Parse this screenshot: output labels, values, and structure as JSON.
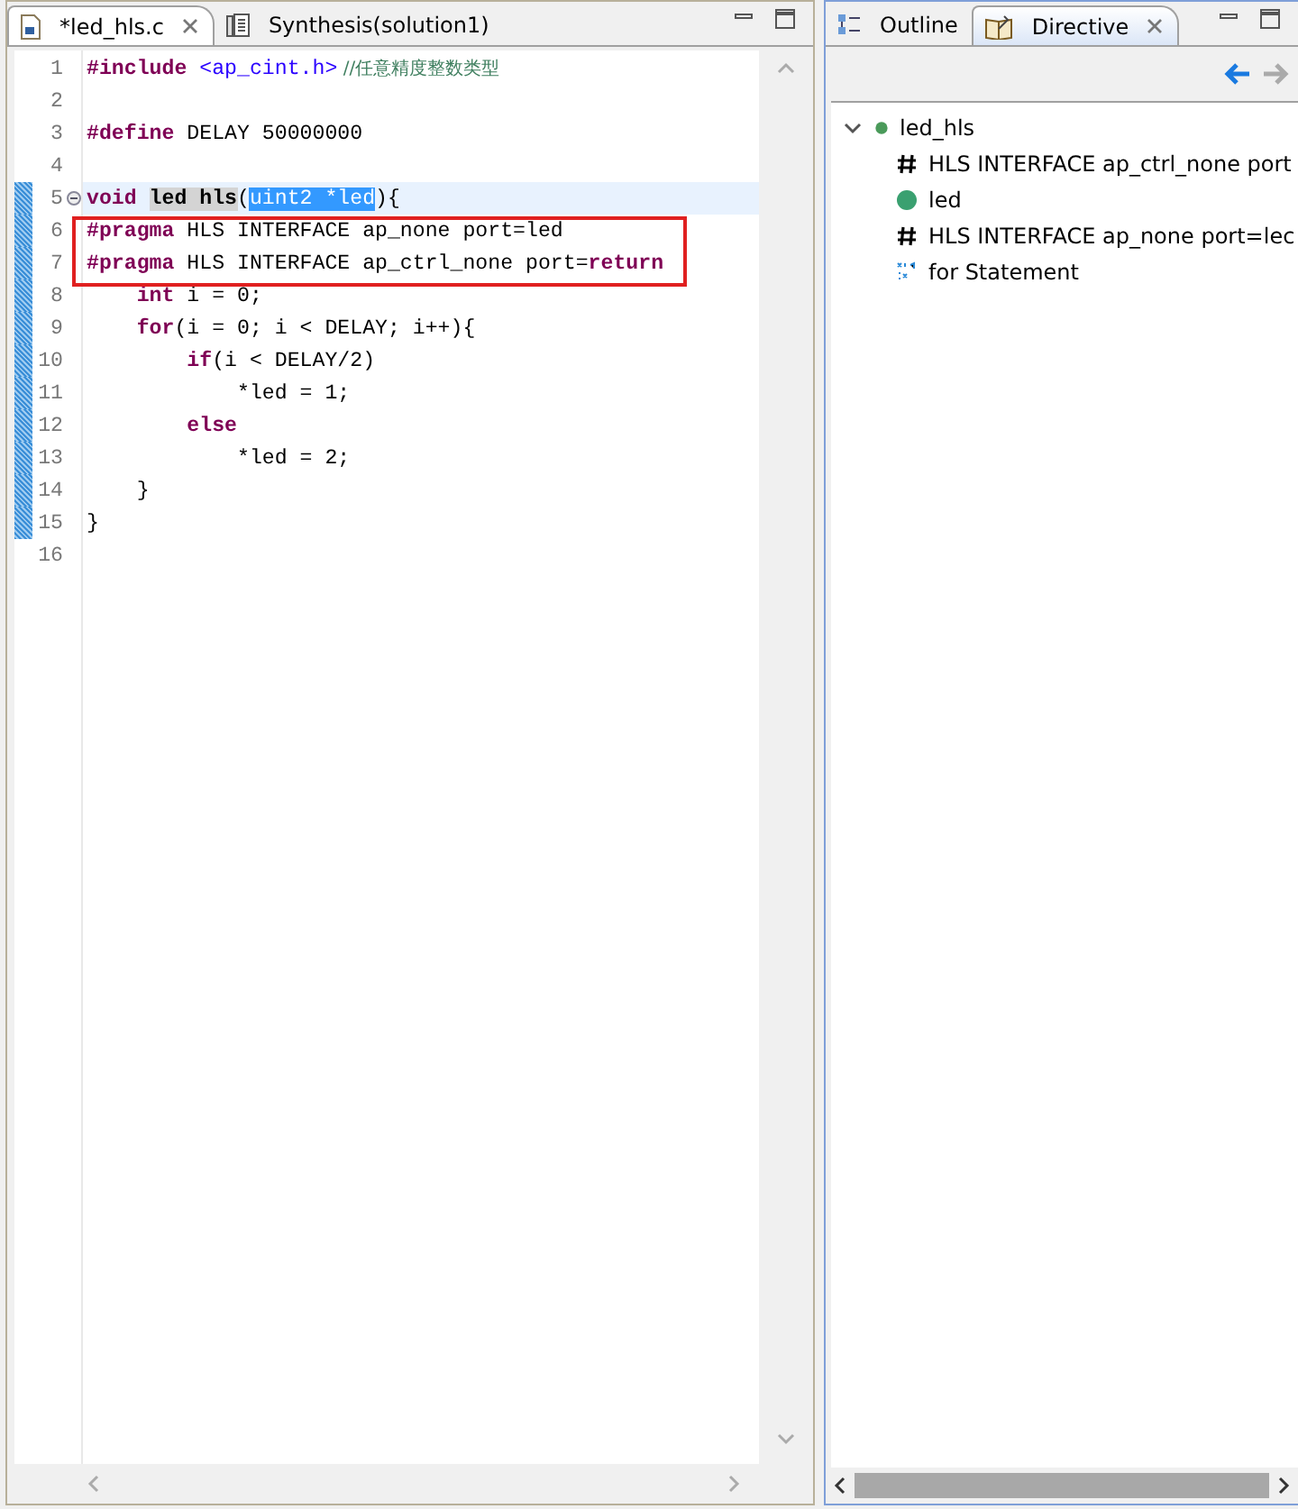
{
  "editor": {
    "tabs": [
      {
        "label": "*led_hls.c",
        "kind": "source",
        "selected": true,
        "closable": true
      },
      {
        "label": "Synthesis(solution1)",
        "kind": "report",
        "selected": false,
        "closable": false
      }
    ],
    "lines": [
      {
        "number": "1",
        "changed": false,
        "current": false,
        "tokens": [
          {
            "kind": "keyword",
            "text": "#include"
          },
          {
            "kind": "header",
            "text": " <ap_cint.h>"
          },
          {
            "kind": "comment",
            "text": " //任意精度整数类型"
          }
        ]
      },
      {
        "number": "2",
        "changed": false,
        "current": false
      },
      {
        "number": "3",
        "changed": false,
        "current": false,
        "tokens": [
          {
            "kind": "keyword",
            "text": "#define"
          },
          {
            "kind": "plain",
            "text": " DELAY 50000000"
          }
        ]
      },
      {
        "number": "4",
        "changed": false,
        "current": false
      },
      {
        "number": "5",
        "changed": true,
        "current": true,
        "fold": true,
        "tokens": [
          {
            "kind": "keyword",
            "text": "void "
          },
          {
            "kind": "occurrence",
            "text": "led hls"
          },
          {
            "kind": "plain",
            "text": "("
          },
          {
            "kind": "selection",
            "text": "uint2 *led"
          },
          {
            "kind": "plain",
            "text": "){"
          }
        ]
      },
      {
        "number": "6",
        "changed": true,
        "current": false,
        "tokens": [
          {
            "kind": "keyword",
            "text": "#pragma"
          },
          {
            "kind": "plain",
            "text": " HLS INTERFACE ap_none port=led"
          }
        ]
      },
      {
        "number": "7",
        "changed": true,
        "current": false,
        "tokens": [
          {
            "kind": "keyword",
            "text": "#pragma"
          },
          {
            "kind": "plain",
            "text": " HLS INTERFACE ap_ctrl_none port="
          },
          {
            "kind": "keyword",
            "text": "return"
          }
        ]
      },
      {
        "number": "8",
        "changed": true,
        "current": false,
        "tokens": [
          {
            "kind": "keyword",
            "text": "    int"
          },
          {
            "kind": "plain",
            "text": " i = 0;"
          }
        ]
      },
      {
        "number": "9",
        "changed": true,
        "current": false,
        "tokens": [
          {
            "kind": "keyword",
            "text": "    for"
          },
          {
            "kind": "plain",
            "text": "(i = 0; i < DELAY; i++){"
          }
        ]
      },
      {
        "number": "10",
        "changed": true,
        "current": false,
        "tokens": [
          {
            "kind": "keyword",
            "text": "        if"
          },
          {
            "kind": "plain",
            "text": "(i < DELAY/2)"
          }
        ]
      },
      {
        "number": "11",
        "changed": true,
        "current": false,
        "tokens": [
          {
            "kind": "plain",
            "text": "            *led = 1;"
          }
        ]
      },
      {
        "number": "12",
        "changed": true,
        "current": false,
        "tokens": [
          {
            "kind": "keyword",
            "text": "        else"
          }
        ]
      },
      {
        "number": "13",
        "changed": true,
        "current": false,
        "tokens": [
          {
            "kind": "plain",
            "text": "            *led = 2;"
          }
        ]
      },
      {
        "number": "14",
        "changed": true,
        "current": false,
        "tokens": [
          {
            "kind": "plain",
            "text": "    }"
          }
        ]
      },
      {
        "number": "15",
        "changed": true,
        "current": false,
        "tokens": [
          {
            "kind": "plain",
            "text": "}"
          }
        ]
      },
      {
        "number": "16",
        "changed": false,
        "current": false
      }
    ]
  },
  "side_panel": {
    "tabs": [
      {
        "label": "Outline",
        "kind": "outline",
        "selected": false,
        "closable": false
      },
      {
        "label": "Directive",
        "kind": "directive",
        "selected": true,
        "closable": true
      }
    ],
    "tree": [
      {
        "label": "led_hls",
        "kind": "function",
        "expanded": true,
        "children": [
          {
            "label": "HLS INTERFACE ap_ctrl_none port",
            "kind": "directive"
          },
          {
            "label": "led",
            "kind": "port"
          },
          {
            "label": "HLS INTERFACE ap_none port=lec",
            "kind": "directive"
          },
          {
            "label": "for Statement",
            "kind": "loop"
          }
        ]
      }
    ]
  }
}
